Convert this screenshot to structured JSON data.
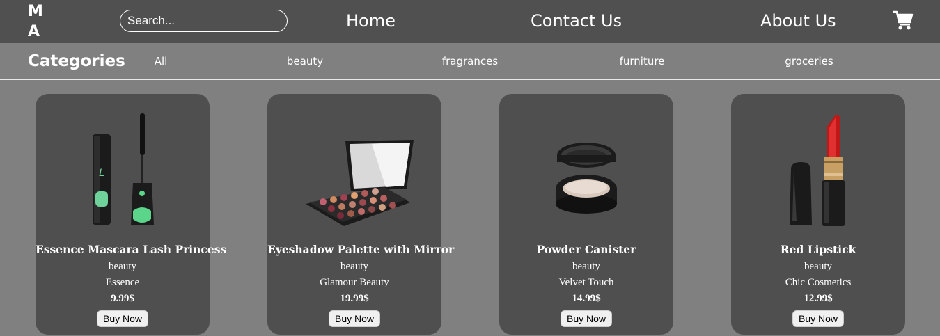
{
  "header": {
    "logo": "M A N U",
    "search_placeholder": "Search...",
    "nav": [
      "Home",
      "Contact Us",
      "About Us"
    ]
  },
  "categories": {
    "title": "Categories",
    "items": [
      "All",
      "beauty",
      "fragrances",
      "furniture",
      "groceries"
    ]
  },
  "products": [
    {
      "title": "Essence Mascara Lash Princess",
      "category": "beauty",
      "brand": "Essence",
      "price": "9.99$",
      "button": "Buy Now",
      "icon": "mascara-icon"
    },
    {
      "title": "Eyeshadow Palette with Mirror",
      "category": "beauty",
      "brand": "Glamour Beauty",
      "price": "19.99$",
      "button": "Buy Now",
      "icon": "eyeshadow-palette-icon"
    },
    {
      "title": "Powder Canister",
      "category": "beauty",
      "brand": "Velvet Touch",
      "price": "14.99$",
      "button": "Buy Now",
      "icon": "powder-compact-icon"
    },
    {
      "title": "Red Lipstick",
      "category": "beauty",
      "brand": "Chic Cosmetics",
      "price": "12.99$",
      "button": "Buy Now",
      "icon": "lipstick-icon"
    }
  ],
  "colors": {
    "header_bg": "#505050",
    "page_bg": "#808080",
    "card_bg": "#4f4f4f",
    "text": "#ffffff"
  }
}
